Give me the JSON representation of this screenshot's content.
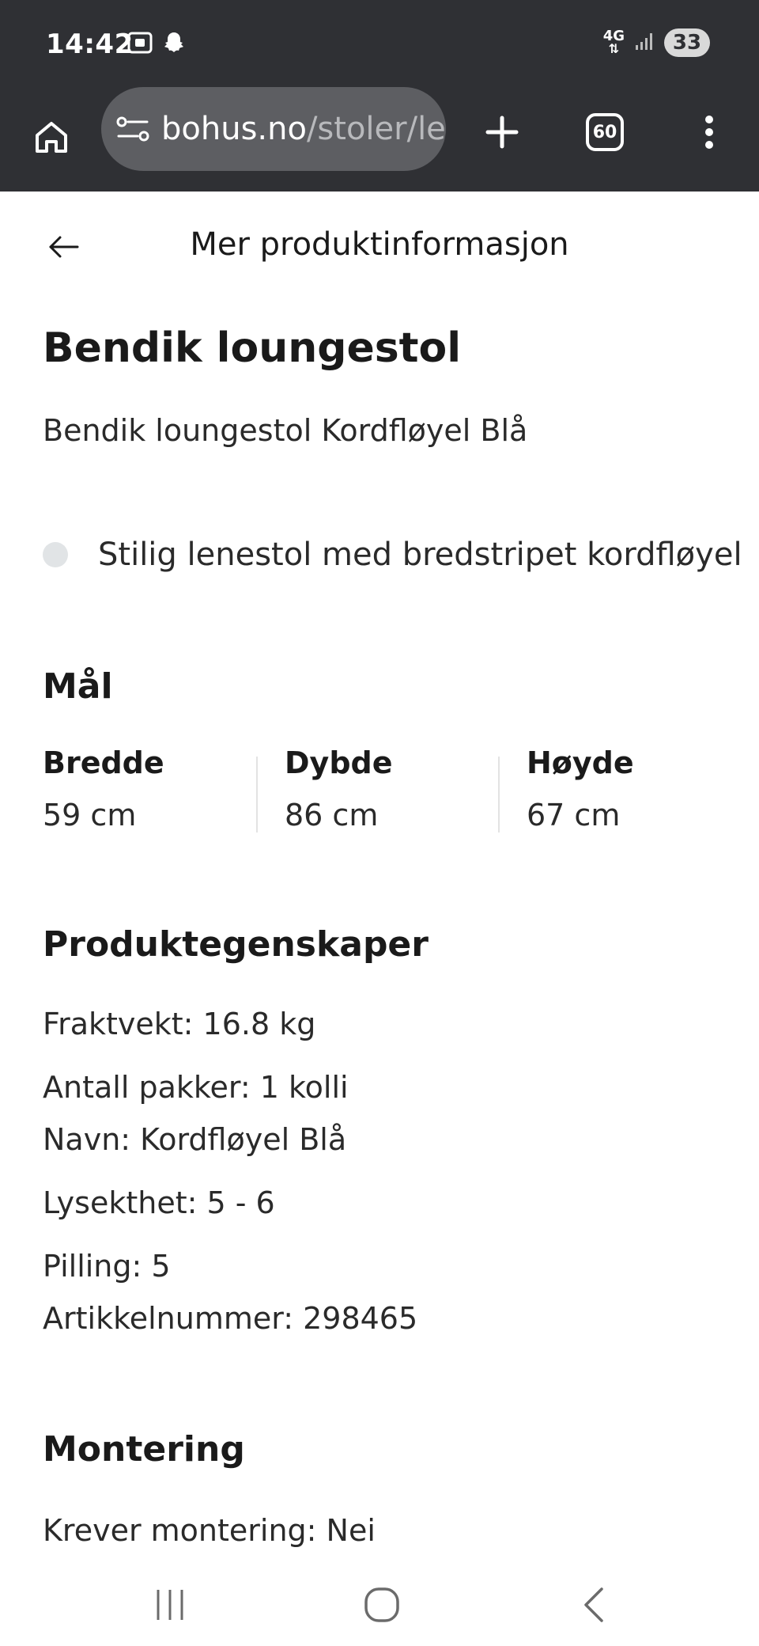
{
  "status_bar": {
    "time": "14:42",
    "network": "4G",
    "battery": "33"
  },
  "browser": {
    "url_domain": "bohus.no",
    "url_path": "/stoler/le",
    "tab_count": "60"
  },
  "header": {
    "title": "Mer produktinformasjon"
  },
  "product": {
    "title": "Bendik loungestol",
    "subtitle": "Bendik loungestol Kordfløyel Blå",
    "bullet": "Stilig lenestol med bredstripet kordfløyel"
  },
  "dimensions": {
    "heading": "Mål",
    "items": [
      {
        "label": "Bredde",
        "value": "59 cm"
      },
      {
        "label": "Dybde",
        "value": "86 cm"
      },
      {
        "label": "Høyde",
        "value": "67 cm"
      }
    ]
  },
  "properties": {
    "heading": "Produktegenskaper",
    "lines": [
      "Fraktvekt: 16.8 kg",
      "Antall pakker: 1 kolli",
      "Navn: Kordfløyel Blå",
      "Lysekthet: 5 - 6",
      "Pilling: 5",
      "Artikkelnummer: 298465"
    ]
  },
  "assembly": {
    "heading": "Montering",
    "line": "Krever montering: Nei"
  },
  "colors": {
    "chrome_bg": "#2f3034",
    "url_pill_bg": "#5d5e62",
    "bullet_dot": "#e1e4e6"
  },
  "icons": {
    "home": "home-icon",
    "site_settings": "site-settings-icon",
    "new_tab": "plus-icon",
    "menu": "more-vertical-icon",
    "back": "arrow-left-icon",
    "nav_recents": "recents-icon",
    "nav_home": "home-circle-icon",
    "nav_back": "chevron-left-icon"
  }
}
